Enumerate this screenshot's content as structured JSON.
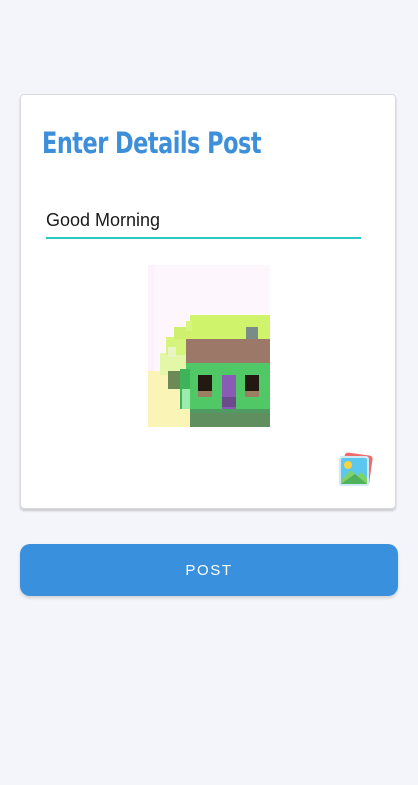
{
  "form": {
    "title": "Enter Details Post",
    "post_text": "Good Morning",
    "image_preview": "house-pixel-art",
    "gallery_icon": "image-gallery-icon"
  },
  "actions": {
    "post_label": "POST"
  },
  "colors": {
    "page_background": "#f4f5fa",
    "title": "#3d8fd9",
    "input_underline": "#2bc7c0",
    "button": "#3990dd"
  }
}
